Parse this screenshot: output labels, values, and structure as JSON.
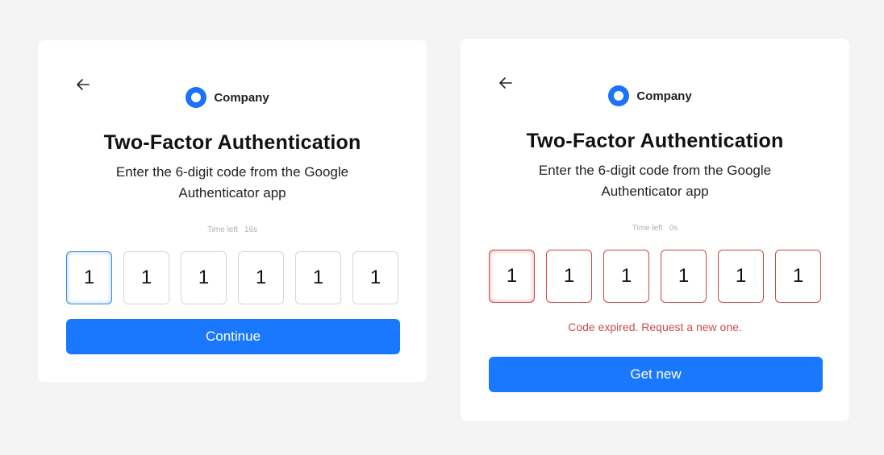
{
  "colors": {
    "page_background": "#f4f4f4",
    "brand_blue": "#1a73f8",
    "button_blue": "#1a78ff",
    "error_red": "#cc4b4b",
    "focus_blue": "#3b8fd8"
  },
  "icons": {
    "back": "arrow-left-icon",
    "logo": "company-logo-icon"
  },
  "left_card": {
    "brand_name": "Company",
    "title": "Two-Factor Authentication",
    "subtitle": "Enter the 6-digit code from the Google Authenticator app",
    "timer_label": "Time left",
    "timer_value": "16s",
    "digits": [
      "1",
      "1",
      "1",
      "1",
      "1",
      "1"
    ],
    "button_label": "Continue"
  },
  "right_card": {
    "brand_name": "Company",
    "title": "Two-Factor Authentication",
    "subtitle": "Enter the 6-digit code from the Google Authenticator app",
    "timer_label": "Time left",
    "timer_value": "0s",
    "digits": [
      "1",
      "1",
      "1",
      "1",
      "1",
      "1"
    ],
    "error_message": "Code expired. Request a new one.",
    "button_label": "Get new"
  }
}
